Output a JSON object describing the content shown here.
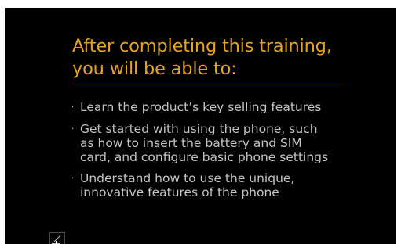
{
  "slide": {
    "title_lines": [
      "After completing this training,",
      "you will be able to:"
    ],
    "bullet_glyph": "·",
    "bullets": [
      {
        "lines": [
          "Learn the product’s key selling features"
        ]
      },
      {
        "lines": [
          "Get started with using the phone, such",
          "as how to  insert the battery and SIM",
          "card, and configure basic phone settings"
        ]
      },
      {
        "lines": [
          "Understand how to use the unique,",
          "innovative features of the phone"
        ]
      }
    ]
  },
  "colors": {
    "background": "#000000",
    "title": "#e8a31c",
    "rule": "#c98a1f",
    "body_text": "#c4c4c4"
  },
  "icons": {
    "corner": "slide-corner-icon"
  }
}
